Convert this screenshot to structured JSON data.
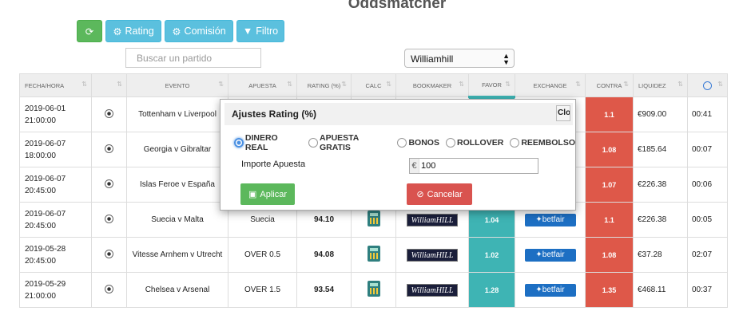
{
  "page": {
    "title": "Oddsmatcher"
  },
  "toolbar": {
    "refresh_icon": "refresh-icon",
    "rating_label": "Rating",
    "comision_label": "Comisión",
    "filtro_label": "Filtro"
  },
  "search": {
    "placeholder": "Buscar un partido"
  },
  "bookmaker_select": {
    "value": "Williamhill"
  },
  "table": {
    "headers": [
      "FECHA/HORA",
      "",
      "EVENTO",
      "APUESTA",
      "RATING (%)",
      "CALC",
      "BOOKMAKER",
      "FAVOR",
      "EXCHANGE",
      "CONTRA",
      "LIQUIDEZ",
      ""
    ],
    "rows": [
      {
        "date": "2019-06-01",
        "time": "21:00:00",
        "event": "Tottenham v Liverpool",
        "bet": "",
        "rating": "",
        "favor": "",
        "contra": "1.1",
        "liquidity": "€909.00",
        "remaining": "00:41"
      },
      {
        "date": "2019-06-07",
        "time": "18:00:00",
        "event": "Georgia v Gibraltar",
        "bet": "",
        "rating": "",
        "favor": "",
        "contra": "1.08",
        "liquidity": "€185.64",
        "remaining": "00:07"
      },
      {
        "date": "2019-06-07",
        "time": "20:45:00",
        "event": "Islas Feroe v España",
        "bet": "",
        "rating": "",
        "favor": "",
        "contra": "1.07",
        "liquidity": "€226.38",
        "remaining": "00:06"
      },
      {
        "date": "2019-06-07",
        "time": "20:45:00",
        "event": "Suecia v Malta",
        "bet": "Suecia",
        "rating": "94.10",
        "favor": "1.04",
        "contra": "1.1",
        "liquidity": "€226.38",
        "remaining": "00:05"
      },
      {
        "date": "2019-05-28",
        "time": "20:45:00",
        "event": "Vitesse Arnhem v Utrecht",
        "bet": "OVER 0.5",
        "rating": "94.08",
        "favor": "1.02",
        "contra": "1.08",
        "liquidity": "€37.28",
        "remaining": "02:07"
      },
      {
        "date": "2019-05-29",
        "time": "21:00:00",
        "event": "Chelsea v Arsenal",
        "bet": "OVER 1.5",
        "rating": "93.54",
        "favor": "1.28",
        "contra": "1.35",
        "liquidity": "€468.11",
        "remaining": "00:37"
      }
    ],
    "bookmaker_logo": "WilliamHILL",
    "exchange_logo": "✦betfair"
  },
  "modal": {
    "title": "Ajustes Rating (%)",
    "close_label": "Close",
    "options": [
      "DINERO REAL",
      "APUESTA GRATIS",
      "BONOS",
      "ROLLOVER",
      "REEMBOLSO"
    ],
    "selected_option": "DINERO REAL",
    "importe_label": "Importe Apuesta",
    "currency": "€",
    "importe_value": "100",
    "apply_label": "Aplicar",
    "cancel_label": "Cancelar"
  },
  "colors": {
    "favor": "#3eb4b4",
    "contra": "#de5849",
    "btn_green": "#5cb85c",
    "btn_blue": "#5bc0de",
    "btn_red": "#d9534f"
  }
}
